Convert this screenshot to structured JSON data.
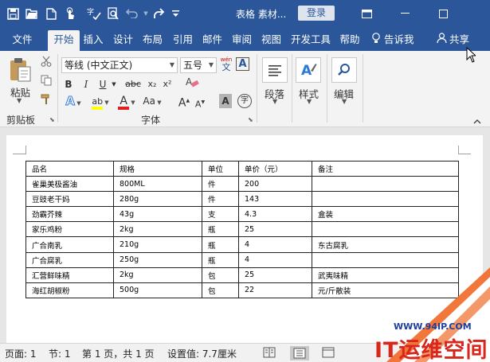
{
  "app": {
    "title": "表格 素材...",
    "login_label": "登录",
    "accent_color": "#2b579a"
  },
  "quick_access": [
    "save-icon",
    "open-icon",
    "new-icon",
    "touch-mode-icon",
    "spelling-icon",
    "find-icon",
    "undo-icon",
    "redo-icon",
    "customize-icon"
  ],
  "tabs": [
    {
      "label": "文件"
    },
    {
      "label": "开始",
      "active": true
    },
    {
      "label": "插入"
    },
    {
      "label": "设计"
    },
    {
      "label": "布局"
    },
    {
      "label": "引用"
    },
    {
      "label": "邮件"
    },
    {
      "label": "审阅"
    },
    {
      "label": "视图"
    },
    {
      "label": "开发工具"
    },
    {
      "label": "帮助"
    }
  ],
  "tell_me": "告诉我",
  "share": "共享",
  "ribbon": {
    "clipboard": {
      "paste": "粘贴",
      "group": "剪贴板"
    },
    "font": {
      "font_name": "等线 (中文正文)",
      "font_size": "五号",
      "wen": "wén",
      "wen_char": "文",
      "bold": "B",
      "italic": "I",
      "underline": "U",
      "strike": "abc",
      "sub": "x₂",
      "sup": "x²",
      "text_effect": "A",
      "highlight": "ab",
      "font_color": "A",
      "change_case": "Aa",
      "grow": "A",
      "shrink": "A",
      "char_shading": "A",
      "enclose": "字",
      "border_char": "A",
      "group": "字体"
    },
    "paragraph": {
      "label": "段落"
    },
    "styles": {
      "label": "样式"
    },
    "editing": {
      "label": "编辑"
    }
  },
  "table": {
    "headers": [
      "品名",
      "规格",
      "单位",
      "单价（元）",
      "备注"
    ],
    "rows": [
      [
        "雀巢美极酱油",
        "800ML",
        "件",
        "200",
        ""
      ],
      [
        "豆豉老干妈",
        "280g",
        "件",
        "143",
        ""
      ],
      [
        "劲霸芥辣",
        "43g",
        "支",
        "4.3",
        "盒装"
      ],
      [
        "家乐鸡粉",
        "2kg",
        "瓶",
        "25",
        ""
      ],
      [
        "广合南乳",
        "210g",
        "瓶",
        "4",
        "东古腐乳"
      ],
      [
        "广合腐乳",
        "250g",
        "瓶",
        "4",
        ""
      ],
      [
        "汇营鲜味精",
        "2kg",
        "包",
        "25",
        "武夷味精"
      ],
      [
        "海红胡椒粉",
        "500g",
        "包",
        "22",
        "元/斤散装"
      ]
    ]
  },
  "status": {
    "page": "页面: 1",
    "section": "节: 1",
    "pages": "第 1 页，共 1 页",
    "setting": "设置值: 7.7厘米"
  },
  "watermark": {
    "url": "WWW.94IP.COM",
    "text": "IT运维空间"
  }
}
